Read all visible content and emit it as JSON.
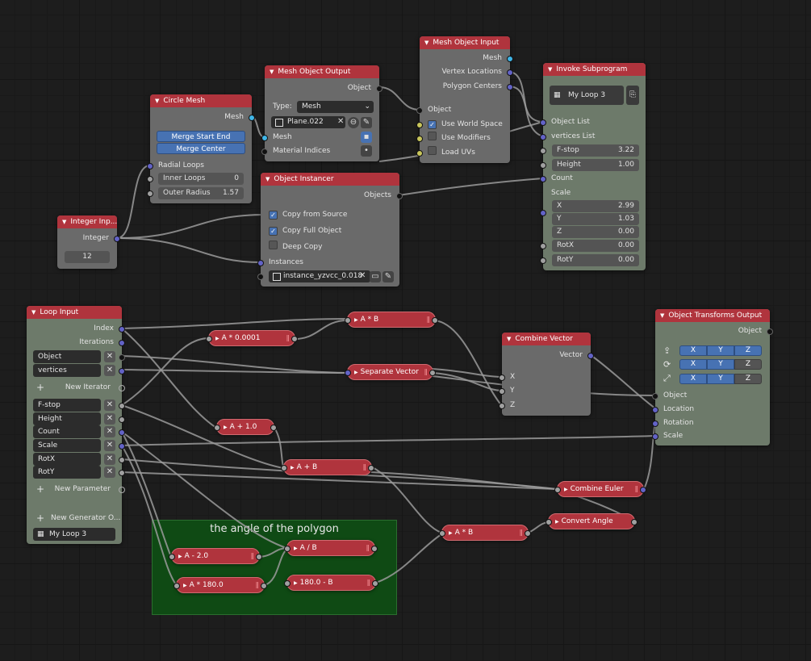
{
  "frame": {
    "label": "the angle of the polygon"
  },
  "circle_mesh": {
    "title": "Circle Mesh",
    "out_mesh": "Mesh",
    "btn_start_end": "Merge Start End",
    "btn_center": "Merge Center",
    "radial_loops": "Radial Loops",
    "inner_loops_label": "Inner Loops",
    "inner_loops_value": "0",
    "outer_radius_label": "Outer Radius",
    "outer_radius_value": "1.57"
  },
  "mesh_object_output": {
    "title": "Mesh Object Output",
    "out_object": "Object",
    "type_label": "Type:",
    "type_value": "Mesh",
    "object_name": "Plane.022",
    "in_mesh": "Mesh",
    "in_material": "Material Indices"
  },
  "mesh_object_input": {
    "title": "Mesh Object Input",
    "out_mesh": "Mesh",
    "out_vertex": "Vertex Locations",
    "out_polygon": "Polygon Centers",
    "in_object": "Object",
    "use_world_space": "Use World Space",
    "use_modifiers": "Use Modifiers",
    "load_uvs": "Load UVs"
  },
  "invoke_subprogram": {
    "title": "Invoke Subprogram",
    "subprogram_name": "My Loop 3",
    "object_list": "Object List",
    "vertices_list": "vertices List",
    "fstop_label": "F-stop",
    "fstop_value": "3.22",
    "height_label": "Height",
    "height_value": "1.00",
    "count": "Count",
    "scale": "Scale",
    "x_label": "X",
    "x_value": "2.99",
    "y_label": "Y",
    "y_value": "1.03",
    "z_label": "Z",
    "z_value": "0.00",
    "rotx_label": "RotX",
    "rotx_value": "0.00",
    "roty_label": "RotY",
    "roty_value": "0.00"
  },
  "object_instancer": {
    "title": "Object Instancer",
    "out_objects": "Objects",
    "copy_from_source": "Copy from Source",
    "copy_full_object": "Copy Full Object",
    "deep_copy": "Deep Copy",
    "in_instances": "Instances",
    "instance_name": "instance_yzvcc_0.018"
  },
  "integer_input": {
    "title": "Integer Inp...",
    "out_integer": "Integer",
    "value": "12"
  },
  "loop_input": {
    "title": "Loop Input",
    "index": "Index",
    "iterations": "Iterations",
    "iterators": [
      "Object",
      "vertices"
    ],
    "new_iterator": "New Iterator",
    "parameters": [
      "F-stop",
      "Height",
      "Count",
      "Scale",
      "RotX",
      "RotY"
    ],
    "new_parameter": "New Parameter",
    "new_generator": "New Generator O...",
    "loop_name": "My Loop 3"
  },
  "math_nodes": {
    "a_times_b_top": "A * B",
    "a_times_00001": "A * 0.0001",
    "separate_vector": "Separate Vector",
    "a_plus_10": "A + 1.0",
    "a_plus_b": "A + B",
    "combine_euler": "Combine Euler",
    "convert_angle": "Convert Angle",
    "a_times_b_mid": "A * B",
    "a_minus_20": "A - 2.0",
    "a_times_180": "A * 180.0",
    "a_div_b": "A / B",
    "b180_minus_b": "180.0 - B"
  },
  "combine_vector": {
    "title": "Combine Vector",
    "out_vector": "Vector",
    "x": "X",
    "y": "Y",
    "z": "Z"
  },
  "object_transforms_output": {
    "title": "Object Transforms Output",
    "out_object": "Object",
    "axes": [
      "X",
      "Y",
      "Z"
    ],
    "in_object": "Object",
    "in_location": "Location",
    "in_rotation": "Rotation",
    "in_scale": "Scale"
  },
  "colors": {
    "header": "#b0343d",
    "accent_blue": "#4772b3",
    "frame_green": "#0f4a14"
  }
}
